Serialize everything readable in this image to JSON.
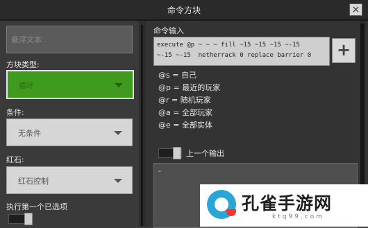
{
  "window": {
    "title": "命令方块",
    "close_label": "×"
  },
  "left": {
    "hover_placeholder": "悬浮文本",
    "block_type_label": "方块类型:",
    "block_type_value": "循环",
    "condition_label": "条件:",
    "condition_value": "无条件",
    "redstone_label": "红石:",
    "redstone_value": "红石控制",
    "execute_first_label": "执行第一个已选项"
  },
  "right": {
    "command_input_label": "命令输入",
    "command_line1": "execute @p ~ ~ ~ fill ~15 ~15 ~15 ~-15",
    "command_line2": "~-15 ~-15  netherrack 0 replace barrier 0",
    "add_label": "+",
    "selectors": [
      "@s = 自己",
      "@p = 最近的玩家",
      "@r = 随机玩家",
      "@a = 全部玩家",
      "@e = 全部实体"
    ],
    "previous_output_label": "上一个输出",
    "output_text": "-"
  },
  "watermark": {
    "title": "孔雀手游网",
    "subtitle": "ktq99.com"
  },
  "colors": {
    "green_dropdown": "#3e9b1e",
    "panel": "#333333"
  }
}
